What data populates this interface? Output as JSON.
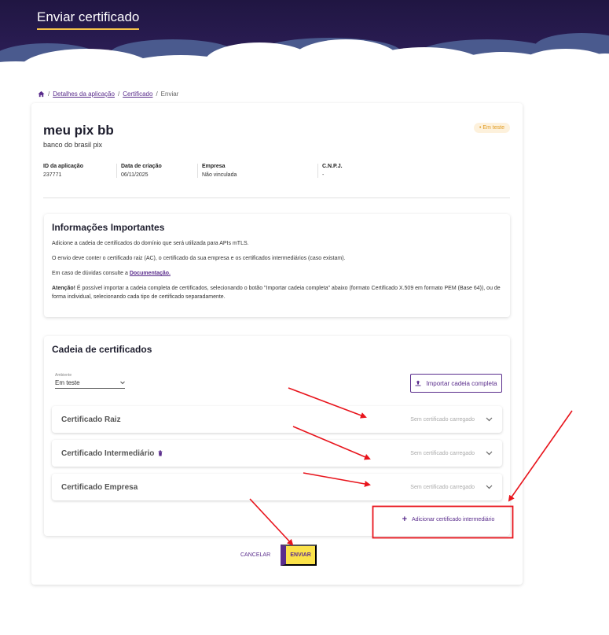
{
  "header": {
    "title": "Enviar certificado"
  },
  "breadcrumb": {
    "items": [
      "Detalhes da aplicação",
      "Certificado"
    ],
    "current": "Enviar",
    "separator": "/"
  },
  "app": {
    "name": "meu pix bb",
    "subtitle": "banco do brasil pix",
    "badge": "• Em teste",
    "meta": [
      {
        "label": "ID da aplicação",
        "value": "237771"
      },
      {
        "label": "Data de criação",
        "value": "06/11/2025"
      },
      {
        "label": "Empresa",
        "value": "Não vinculada"
      },
      {
        "label": "C.N.P.J.",
        "value": "-"
      }
    ]
  },
  "info": {
    "title": "Informações Importantes",
    "p1": "Adicione a cadeia de certificados do domínio que será utilizada para APIs mTLS.",
    "p2": "O envio deve conter o certificado raiz (AC), o certificado da sua empresa e os certificados intermediários (caso existam).",
    "p3_prefix": "Em caso de dúvidas consulte a ",
    "p3_link": "Documentação.",
    "p4_bold": "Atenção!",
    "p4_text": " É possível importar a cadeia completa de certificados, selecionando o botão \"Importar cadeia completa\" abaixo (formato Certificado X.509 em formato PEM (Base 64)), ou de forma individual, selecionando cada tipo de certificado separadamente."
  },
  "chain": {
    "title": "Cadeia de certificados",
    "env_label": "Ambiente",
    "env_value": "Em teste",
    "import_label": "Importar cadeia completa",
    "certs": [
      {
        "name": "Certificado Raiz",
        "status": "Sem certificado carregado"
      },
      {
        "name": "Certificado Intermediário",
        "status": "Sem certificado carregado"
      },
      {
        "name": "Certificado Empresa",
        "status": "Sem certificado carregado"
      }
    ],
    "add_label": "Adicionar certificado intermediário"
  },
  "actions": {
    "cancel": "CANCELAR",
    "send": "ENVIAR"
  },
  "colors": {
    "accent": "#5a2d8c",
    "yellow": "#fbe24a",
    "header": "#201642",
    "annotation": "#e8141c"
  }
}
